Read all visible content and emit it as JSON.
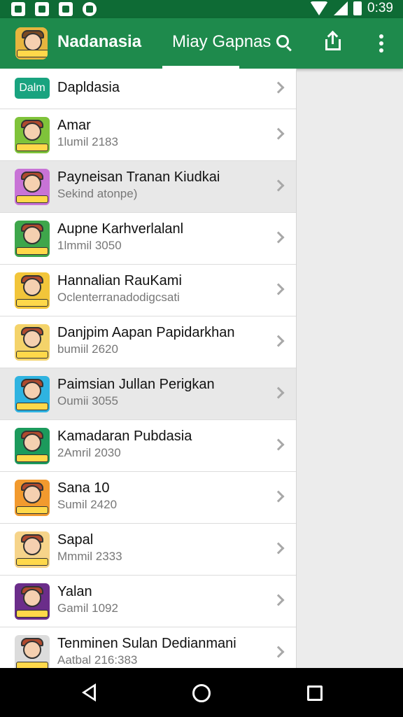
{
  "status_bar": {
    "time": "0:39",
    "icons": [
      "photo-icon",
      "edit-icon",
      "video-icon",
      "cloud-icon"
    ]
  },
  "app_bar": {
    "title": "Nadanasia",
    "tab_label": "Miay Gapnas",
    "icons": [
      "search-icon",
      "share-icon",
      "more-vert-icon"
    ],
    "colors": {
      "bar": "#1e8a4c",
      "status": "#0e6b35"
    }
  },
  "list": {
    "header": {
      "badge": "Dalm",
      "title": "Dapldasia"
    },
    "items": [
      {
        "title": "Amar",
        "subtitle": "1lumil 2183",
        "color": "#7fc33a",
        "selected": false
      },
      {
        "title": "Payneisan Tranan Kiudkai",
        "subtitle": "Sekind atonpe)",
        "color": "#c873d6",
        "selected": true
      },
      {
        "title": "Aupne Karhverlalanl",
        "subtitle": "1lmmil 3050",
        "color": "#3ea64b",
        "selected": false
      },
      {
        "title": "Hannalian RauKami",
        "subtitle": "Oclenterranadodigcsati",
        "color": "#f2c53a",
        "selected": false
      },
      {
        "title": "Danjpim Aapan Papidarkhan",
        "subtitle": "bumiil 2620",
        "color": "#f4d36a",
        "selected": false
      },
      {
        "title": "Paimsian Jullan Perigkan",
        "subtitle": "Oumii 3055",
        "color": "#2fb3e0",
        "selected": true
      },
      {
        "title": "Kamadaran Pubdasia",
        "subtitle": "2Amril 2030",
        "color": "#1c9a5c",
        "selected": false
      },
      {
        "title": "Sana 10",
        "subtitle": "Sumil 2420",
        "color": "#f29a2e",
        "selected": false
      },
      {
        "title": "Sapal",
        "subtitle": "Mmmil 2333",
        "color": "#f6d48a",
        "selected": false
      },
      {
        "title": "Yalan",
        "subtitle": "Gamil 1092",
        "color": "#6b2d8a",
        "selected": false
      },
      {
        "title": "Tenminen Sulan Dedianmani",
        "subtitle": "Aatbal 216:383",
        "color": "#dcdcdc",
        "selected": false
      }
    ]
  },
  "nav_bar": {
    "icons": [
      "back-icon",
      "home-icon",
      "recents-icon"
    ]
  }
}
